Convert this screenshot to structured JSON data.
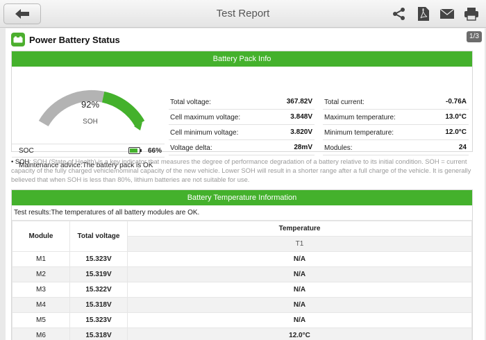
{
  "header": {
    "title": "Test Report"
  },
  "page": {
    "indicator": "1/3"
  },
  "section": {
    "title": "Power Battery Status"
  },
  "pack": {
    "heading": "Battery Pack Info",
    "soh_percent": "92%",
    "soh_label": "SOH",
    "soh_value": 0.92,
    "soc_label": "SOC",
    "soc_value": "66%",
    "maintenance": "Maintenance advice:The battery pack is OK",
    "left_items": [
      {
        "label": "Total voltage:",
        "value": "367.82V"
      },
      {
        "label": "Cell maximum voltage:",
        "value": "3.848V"
      },
      {
        "label": "Cell minimum voltage:",
        "value": "3.820V"
      },
      {
        "label": "Voltage delta:",
        "value": "28mV"
      }
    ],
    "right_items": [
      {
        "label": "Total current:",
        "value": "-0.76A"
      },
      {
        "label": "Maximum temperature:",
        "value": "13.0°C"
      },
      {
        "label": "Minimum temperature:",
        "value": "12.0°C"
      },
      {
        "label": "Modules:",
        "value": "24"
      }
    ]
  },
  "note": {
    "bullet": "• SOH",
    "text": ": SOH (State of Health) is a key indicator that measures the degree of performance degradation of a battery relative to its initial condition. SOH = current capacity of the fully charged vehicle/nominal capacity of the new vehicle. Lower SOH will result in a shorter range after a full charge of the vehicle. It is generally believed that when SOH is less than 80%, lithium batteries are not suitable for use."
  },
  "temp": {
    "heading": "Battery Temperature Information",
    "result": "Test results:The temperatures of all battery modules are OK.",
    "col_module": "Module",
    "col_voltage": "Total voltage",
    "col_temp": "Temperature",
    "col_t1": "T1",
    "rows": [
      {
        "module": "M1",
        "voltage": "15.323V",
        "t1": "N/A"
      },
      {
        "module": "M2",
        "voltage": "15.319V",
        "t1": "N/A"
      },
      {
        "module": "M3",
        "voltage": "15.322V",
        "t1": "N/A"
      },
      {
        "module": "M4",
        "voltage": "15.318V",
        "t1": "N/A"
      },
      {
        "module": "M5",
        "voltage": "15.323V",
        "t1": "N/A"
      },
      {
        "module": "M6",
        "voltage": "15.318V",
        "t1": "12.0°C"
      }
    ]
  },
  "colors": {
    "accent": "#44b12c",
    "gauge_bg": "#b3b3b3"
  },
  "icons": [
    "back-arrow-icon",
    "share-icon",
    "pdf-icon",
    "mail-icon",
    "print-icon",
    "battery-icon"
  ]
}
